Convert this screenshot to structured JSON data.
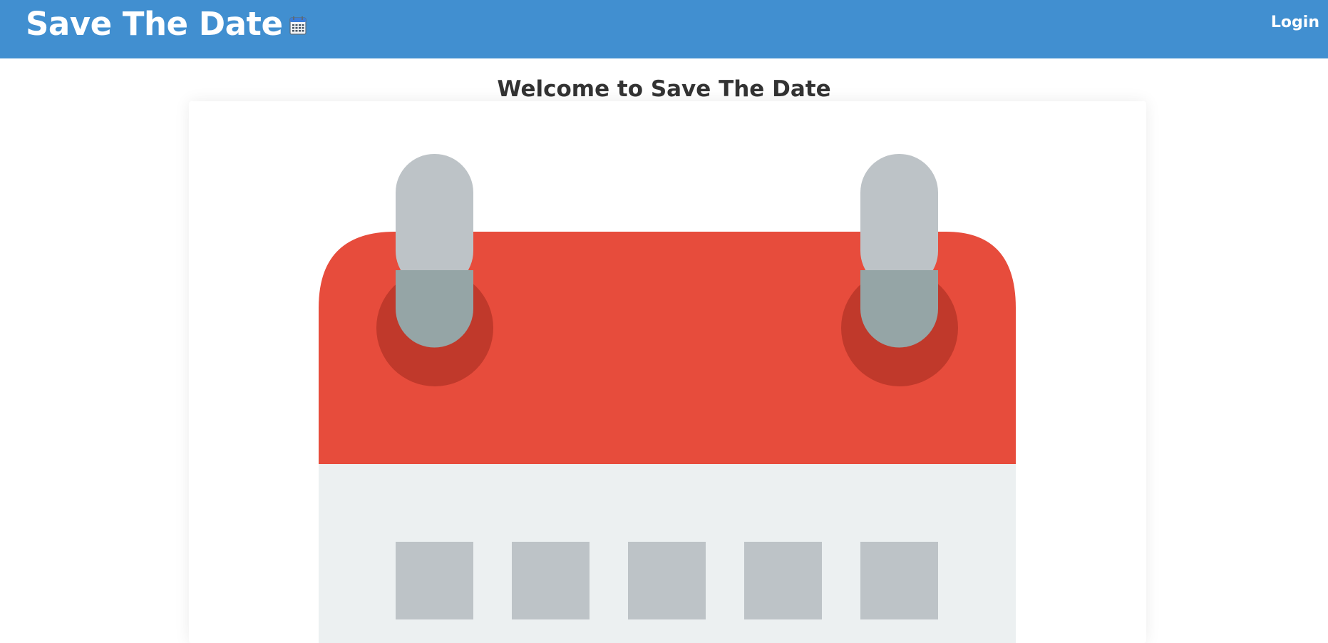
{
  "navbar": {
    "brand_label": "Save The Date",
    "brand_icon": "calendar-icon",
    "login_label": "Login",
    "background_color": "#418fd0"
  },
  "main": {
    "title": "Welcome to Save The Date",
    "hero_image": {
      "icon": "calendar-icon",
      "colors": {
        "header": "#e74c3c",
        "ring_socket": "#c0392b",
        "ring_top": "#bdc3c7",
        "ring_bottom": "#95a5a6",
        "body": "#ecf0f1",
        "day_cell": "#bdc3c7"
      }
    }
  }
}
